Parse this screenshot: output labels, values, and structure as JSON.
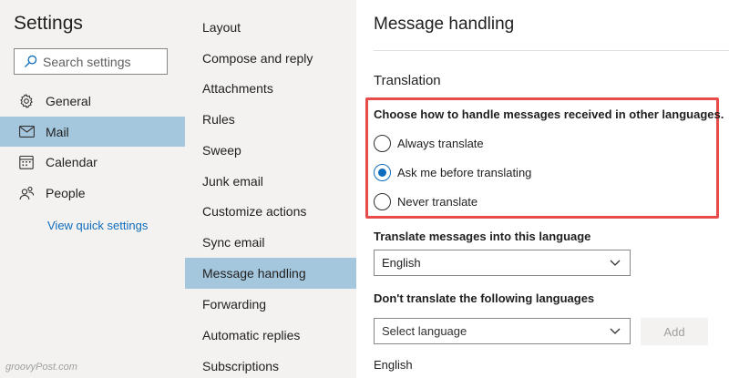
{
  "settings": {
    "title": "Settings",
    "search_placeholder": "Search settings",
    "nav": [
      {
        "label": "General",
        "icon": "gear-icon"
      },
      {
        "label": "Mail",
        "icon": "mail-icon",
        "selected": true
      },
      {
        "label": "Calendar",
        "icon": "calendar-icon"
      },
      {
        "label": "People",
        "icon": "people-icon"
      }
    ],
    "quick_link": "View quick settings"
  },
  "mail_menu": {
    "items": [
      {
        "label": "Layout"
      },
      {
        "label": "Compose and reply"
      },
      {
        "label": "Attachments"
      },
      {
        "label": "Rules"
      },
      {
        "label": "Sweep"
      },
      {
        "label": "Junk email"
      },
      {
        "label": "Customize actions"
      },
      {
        "label": "Sync email"
      },
      {
        "label": "Message handling",
        "selected": true
      },
      {
        "label": "Forwarding"
      },
      {
        "label": "Automatic replies"
      },
      {
        "label": "Subscriptions"
      }
    ]
  },
  "panel": {
    "title": "Message handling",
    "section": "Translation",
    "question": "Choose how to handle messages received in other languages.",
    "options": [
      {
        "label": "Always translate",
        "checked": false
      },
      {
        "label": "Ask me before translating",
        "checked": true
      },
      {
        "label": "Never translate",
        "checked": false
      }
    ],
    "translate_into_label": "Translate messages into this language",
    "translate_into_value": "English",
    "dont_translate_label": "Don't translate the following languages",
    "select_language_placeholder": "Select language",
    "add_label": "Add",
    "excluded_languages": [
      "English"
    ]
  },
  "watermark": "groovyPost.com",
  "colors": {
    "accent": "#0f6cbd",
    "selected_bg": "#a5c7de",
    "highlight_border": "#e84c4a",
    "sidebar_bg": "#f3f2f1"
  }
}
